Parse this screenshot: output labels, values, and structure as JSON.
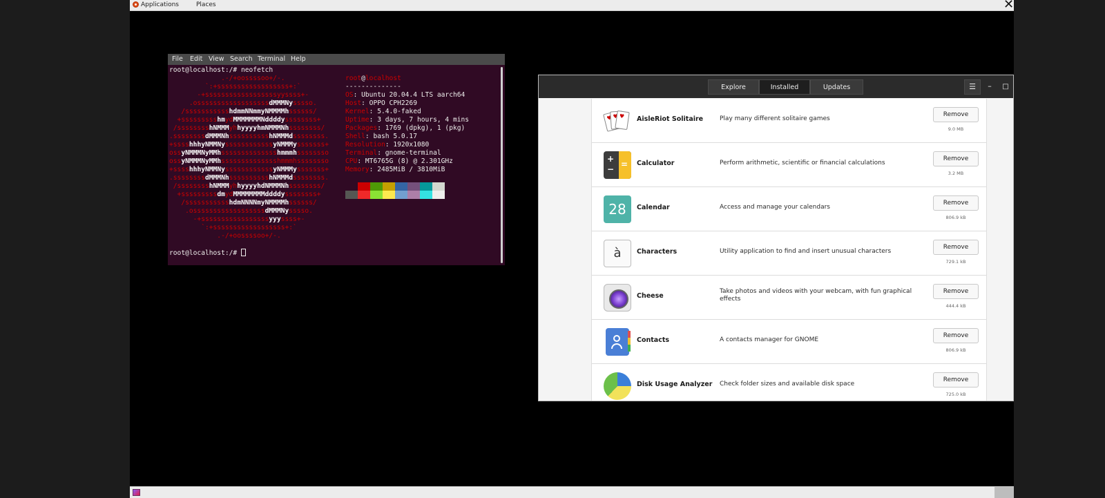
{
  "top_panel": {
    "applications": "Applications",
    "places": "Places"
  },
  "terminal": {
    "menu": [
      "File",
      "Edit",
      "View",
      "Search",
      "Terminal",
      "Help"
    ],
    "command_line": "root@localhost:/# neofetch",
    "user": "root",
    "at": "@",
    "host": "localhost",
    "separator": "--------------",
    "info": [
      {
        "key": "OS",
        "value": "Ubuntu 20.04.4 LTS aarch64"
      },
      {
        "key": "Host",
        "value": "OPPO CPH2269"
      },
      {
        "key": "Kernel",
        "value": "5.4.0-faked"
      },
      {
        "key": "Uptime",
        "value": "3 days, 7 hours, 4 mins"
      },
      {
        "key": "Packages",
        "value": "1769 (dpkg), 1 (pkg)"
      },
      {
        "key": "Shell",
        "value": "bash 5.0.17"
      },
      {
        "key": "Resolution",
        "value": "1920x1080"
      },
      {
        "key": "Terminal",
        "value": "gnome-terminal"
      },
      {
        "key": "CPU",
        "value": "MT6765G (8) @ 2.301GHz"
      },
      {
        "key": "Memory",
        "value": "2485MiB / 3810MiB"
      }
    ],
    "palette_top": [
      "#300a24",
      "#cc0000",
      "#4e9a06",
      "#c4a000",
      "#3465a4",
      "#75507b",
      "#06989a",
      "#d3d7cf"
    ],
    "palette_bottom": [
      "#555753",
      "#ef2929",
      "#8ae234",
      "#fce94f",
      "#729fcf",
      "#ad7fa8",
      "#34e2e2",
      "#eeeeec"
    ],
    "prompt": "root@localhost:/# ",
    "logo_lines": [
      [
        [
          "r",
          "             .-/+oossssoo+/-."
        ]
      ],
      [
        [
          "r",
          "         `:+ssssssssssssssssss+:`"
        ]
      ],
      [
        [
          "r",
          "       -+ssssssssssssssssssyyssss+-"
        ]
      ],
      [
        [
          "r",
          "     .ossssssssssssssssss"
        ],
        [
          "w",
          "dMMMNy"
        ],
        [
          "r",
          "sssso."
        ]
      ],
      [
        [
          "r",
          "   /sssssssssss"
        ],
        [
          "w",
          "hdmmNNmmyNMMMMh"
        ],
        [
          "r",
          "ssssss/"
        ]
      ],
      [
        [
          "r",
          "  +sssssssss"
        ],
        [
          "w",
          "hm"
        ],
        [
          "r",
          "yd"
        ],
        [
          "w",
          "MMMMMMMNddddy"
        ],
        [
          "r",
          "ssssssss+"
        ]
      ],
      [
        [
          "r",
          " /ssssssss"
        ],
        [
          "w",
          "hNMMM"
        ],
        [
          "r",
          "yh"
        ],
        [
          "w",
          "hyyyyhmNMMMNh"
        ],
        [
          "r",
          "ssssssss/"
        ]
      ],
      [
        [
          "r",
          ".ssssssss"
        ],
        [
          "w",
          "dMMMNh"
        ],
        [
          "r",
          "ssssssssss"
        ],
        [
          "w",
          "hNMMMd"
        ],
        [
          "r",
          "ssssssss."
        ]
      ],
      [
        [
          "r",
          "+ssss"
        ],
        [
          "w",
          "hhhyNMMNy"
        ],
        [
          "r",
          "ssssssssssss"
        ],
        [
          "w",
          "yNMMMy"
        ],
        [
          "r",
          "sssssss+"
        ]
      ],
      [
        [
          "r",
          "oss"
        ],
        [
          "w",
          "yNMMMNyMMh"
        ],
        [
          "r",
          "ssssssssssssss"
        ],
        [
          "w",
          "hmmmh"
        ],
        [
          "r",
          "ssssssso"
        ]
      ],
      [
        [
          "r",
          "oss"
        ],
        [
          "w",
          "yNMMMNyMMh"
        ],
        [
          "r",
          "sssssssssssssshmmmhssssssso"
        ]
      ],
      [
        [
          "r",
          "+ssss"
        ],
        [
          "w",
          "hhhyNMMNy"
        ],
        [
          "r",
          "ssssssssssss"
        ],
        [
          "w",
          "yNMMMy"
        ],
        [
          "r",
          "sssssss+"
        ]
      ],
      [
        [
          "r",
          ".ssssssss"
        ],
        [
          "w",
          "dMMMNh"
        ],
        [
          "r",
          "ssssssssss"
        ],
        [
          "w",
          "hNMMMd"
        ],
        [
          "r",
          "ssssssss."
        ]
      ],
      [
        [
          "r",
          " /ssssssss"
        ],
        [
          "w",
          "hNMMM"
        ],
        [
          "r",
          "yh"
        ],
        [
          "w",
          "hyyyyhdNMMMNh"
        ],
        [
          "r",
          "ssssssss/"
        ]
      ],
      [
        [
          "r",
          "  +sssssssss"
        ],
        [
          "w",
          "dm"
        ],
        [
          "r",
          "yd"
        ],
        [
          "w",
          "MMMMMMMMddddy"
        ],
        [
          "r",
          "ssssssss+"
        ]
      ],
      [
        [
          "r",
          "   /sssssssssss"
        ],
        [
          "w",
          "hdmNNNNmyNMMMMh"
        ],
        [
          "r",
          "ssssss/"
        ]
      ],
      [
        [
          "r",
          "    .ossssssssssssssssss"
        ],
        [
          "w",
          "dMMMNy"
        ],
        [
          "r",
          "sssso."
        ]
      ],
      [
        [
          "r",
          "      -+sssssssssssssssss"
        ],
        [
          "w",
          "yyy"
        ],
        [
          "r",
          "ssss+-"
        ]
      ],
      [
        [
          "r",
          "        `:+ssssssssssssssssss+:`"
        ]
      ],
      [
        [
          "r",
          "            .-/+oossssoo+/-."
        ]
      ]
    ]
  },
  "software": {
    "tabs": [
      "Explore",
      "Installed",
      "Updates"
    ],
    "active_tab": "Installed",
    "menu_icon": "hamburger-icon",
    "minimize_icon": "minimize-icon",
    "maximize_icon": "maximize-icon",
    "apps": [
      {
        "name": "AisleRiot Solitaire",
        "desc": "Play many different solitaire games",
        "button": "Remove",
        "size": "9.0 MB",
        "icon": "solitaire-icon"
      },
      {
        "name": "Calculator",
        "desc": "Perform arithmetic, scientific or financial calculations",
        "button": "Remove",
        "size": "3.2 MB",
        "icon": "calculator-icon"
      },
      {
        "name": "Calendar",
        "desc": "Access and manage your calendars",
        "button": "Remove",
        "size": "806.9 kB",
        "icon": "calendar-icon",
        "icon_text": "28"
      },
      {
        "name": "Characters",
        "desc": "Utility application to find and insert unusual characters",
        "button": "Remove",
        "size": "729.1 kB",
        "icon": "characters-icon",
        "icon_text": "à"
      },
      {
        "name": "Cheese",
        "desc": "Take photos and videos with your webcam, with fun graphical effects",
        "button": "Remove",
        "size": "444.4 kB",
        "icon": "cheese-icon"
      },
      {
        "name": "Contacts",
        "desc": "A contacts manager for GNOME",
        "button": "Remove",
        "size": "806.9 kB",
        "icon": "contacts-icon"
      },
      {
        "name": "Disk Usage Analyzer",
        "desc": "Check folder sizes and available disk space",
        "button": "Remove",
        "size": "725.0 kB",
        "icon": "disk-usage-icon"
      }
    ]
  }
}
